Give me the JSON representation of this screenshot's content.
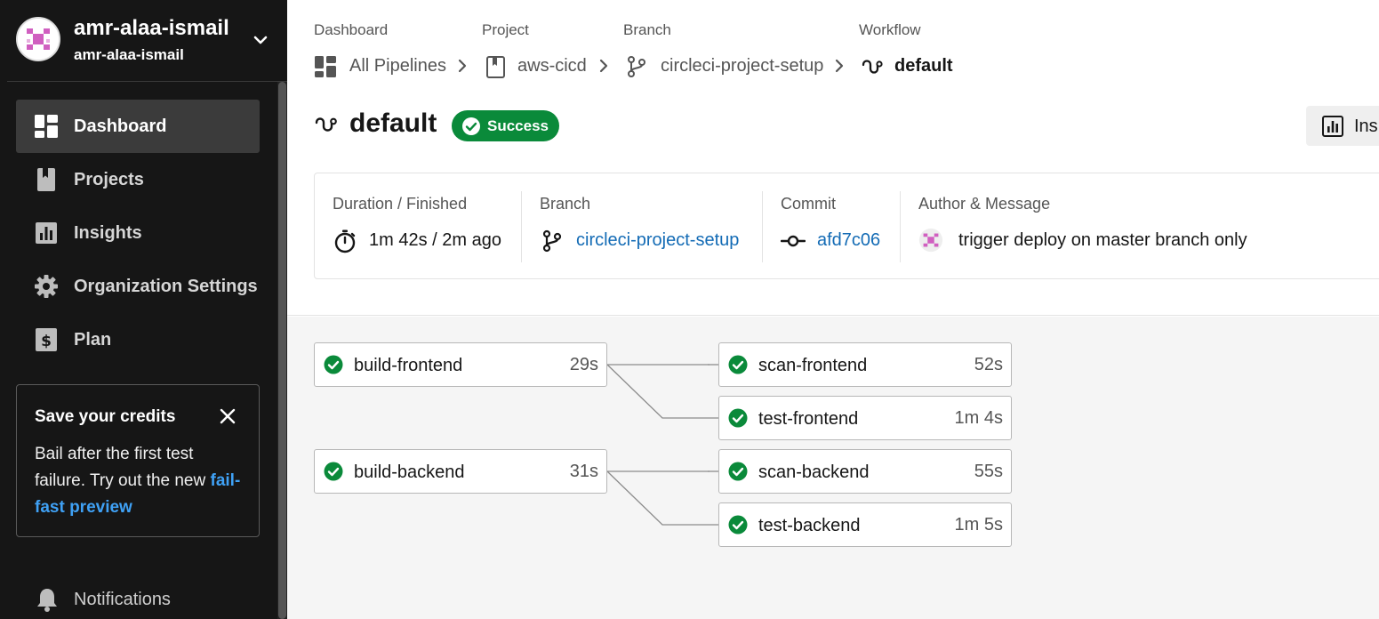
{
  "org": {
    "name": "amr-alaa-ismail",
    "subtitle": "amr-alaa-ismail"
  },
  "nav": {
    "items": [
      {
        "label": "Dashboard",
        "icon": "dashboard-icon",
        "active": true
      },
      {
        "label": "Projects",
        "icon": "book-icon"
      },
      {
        "label": "Insights",
        "icon": "bar-chart-icon"
      },
      {
        "label": "Organization Settings",
        "icon": "gear-icon"
      },
      {
        "label": "Plan",
        "icon": "dollar-icon"
      }
    ],
    "notifications": "Notifications"
  },
  "credits": {
    "title": "Save your credits",
    "body": "Bail after the first test failure. Try out the new",
    "link": "fail-fast preview"
  },
  "breadcrumb": {
    "labels": [
      "Dashboard",
      "Project",
      "Branch",
      "Workflow"
    ],
    "items": [
      "All Pipelines",
      "aws-cicd",
      "circleci-project-setup",
      "default"
    ]
  },
  "workflow": {
    "title": "default",
    "status": "Success",
    "insights_button": "Ins"
  },
  "summary": {
    "duration_label": "Duration / Finished",
    "duration_value": "1m 42s / 2m ago",
    "branch_label": "Branch",
    "branch_value": "circleci-project-setup",
    "commit_label": "Commit",
    "commit_value": "afd7c06",
    "author_label": "Author & Message",
    "author_message": "trigger deploy on master branch only"
  },
  "jobs": [
    {
      "name": "build-frontend",
      "duration": "29s",
      "status": "success"
    },
    {
      "name": "scan-frontend",
      "duration": "52s",
      "status": "success"
    },
    {
      "name": "test-frontend",
      "duration": "1m 4s",
      "status": "success"
    },
    {
      "name": "build-backend",
      "duration": "31s",
      "status": "success"
    },
    {
      "name": "scan-backend",
      "duration": "55s",
      "status": "success"
    },
    {
      "name": "test-backend",
      "duration": "1m 5s",
      "status": "success"
    }
  ],
  "colors": {
    "sidebar_bg": "#161616",
    "active_nav": "#3b3b3b",
    "success": "#0a8a3a",
    "link": "#136bb5",
    "credits_link": "#3fa1f5",
    "canvas_bg": "#f5f5f5"
  }
}
